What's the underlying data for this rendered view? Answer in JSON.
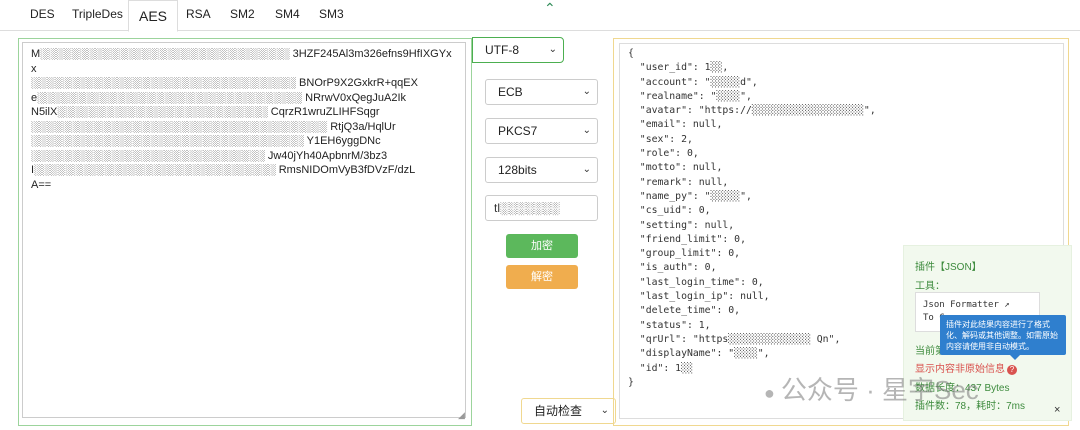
{
  "tabs": [
    "DES",
    "TripleDes",
    "AES",
    "RSA",
    "SM2",
    "SM4",
    "SM3"
  ],
  "active_tab": "AES",
  "input": {
    "lines": [
      "M░░░░░░░░░░░░░░░░░░░░░░░░░░░░░░░░ 3HZF245Al3m326efns9HfIXGYxx",
      "░░░░░░░░░░░░░░░░░░░░░░░░░░░░░░░░░░ BNOrP9X2GxkrR+qqEX",
      "e░░░░░░░░░░░░░░░░░░░░░░░░░░░░░░░░░░ NRrwV0xQegJuA2Ik",
      "N5ilX░░░░░░░░░░░░░░░░░░░░░░░░░░░ CqrzR1wruZLIHFSqgr",
      "░░░░░░░░░░░░░░░░░░░░░░░░░░░░░░░░░░░░░░ RtjQ3a/HqlUr",
      "░░░░░░░░░░░░░░░░░░░░░░░░░░░░░░░░░░░ Y1EH6yggDNc",
      "░░░░░░░░░░░░░░░░░░░░░░░░░░░░░░ Jw40jYh40ApbnrM/3bz3",
      "I░░░░░░░░░░░░░░░░░░░░░░░░░░░░░░░ RmsNIDOmVyB3fDVzF/dzL",
      "A=="
    ]
  },
  "controls": {
    "encoding": "UTF-8",
    "mode": "ECB",
    "padding": "PKCS7",
    "keysize": "128bits",
    "key_value": "tl░░░░░░░",
    "encrypt_label": "加密",
    "decrypt_label": "解密",
    "auto_detect": "自动检查"
  },
  "output_lines": [
    "{",
    "  \"user_id\": 1░░,",
    "  \"account\": \"░░░░░d\",",
    "  \"realname\": \"░░░░\",",
    "  \"avatar\": \"https://░░░░░░░░░░░░░░░░░░░\",",
    "  \"email\": null,",
    "  \"sex\": 2,",
    "  \"role\": 0,",
    "  \"motto\": null,",
    "  \"remark\": null,",
    "  \"name_py\": \"░░░░░\",",
    "  \"cs_uid\": 0,",
    "  \"setting\": null,",
    "  \"friend_limit\": 0,",
    "  \"group_limit\": 0,",
    "  \"is_auth\": 0,",
    "  \"last_login_time\": 0,",
    "  \"last_login_ip\": null,",
    "  \"delete_time\": 0,",
    "  \"status\": 1,",
    "  \"qrUrl\": \"https░░░░░░░░░░░░░░ Qn\",",
    "  \"displayName\": \"░░░░\",",
    "  \"id\": 1░░",
    "}"
  ],
  "plugin": {
    "title": "插件【JSON】",
    "tool_label": "工具：",
    "tool_line1": "Json Formatter",
    "tool_line2": "To C",
    "current_label": "当前第",
    "warning": "显示内容非原始信息",
    "length": "数据长度：437 Bytes",
    "count": "插件数：78，耗时：7ms",
    "close": "×",
    "tooltip": "插件对此结果内容进行了格式化、解码或其他调整。如需原始内容请使用非自动模式。"
  },
  "watermark": "公众号 · 星宇Sec"
}
